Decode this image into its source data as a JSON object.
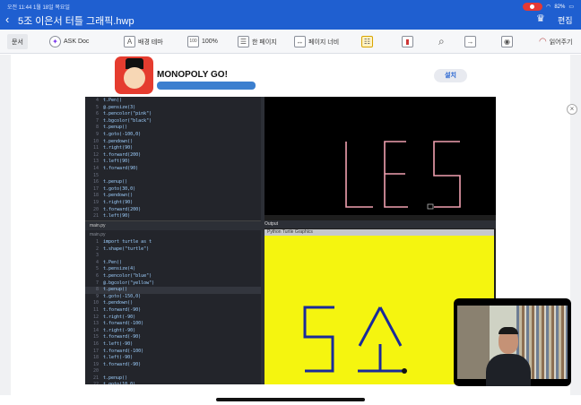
{
  "status": {
    "time_date": "오전 11:44  1월 18일 목요일",
    "battery": "82%"
  },
  "title_bar": {
    "back_glyph": "‹",
    "doc_title": "5조 이은서 터틀 그래픽.hwp",
    "edit_label": "편집"
  },
  "toolbar": {
    "menu_label": "문서",
    "ask_doc": "ASK Doc",
    "background_theme": "배경 테마",
    "zoom": "100%",
    "one_page": "한 페이지",
    "page_width": "페이지 너비",
    "read_aloud": "읽어주기"
  },
  "ad": {
    "title": "MONOPOLY GO!",
    "install_label": "설치",
    "close_glyph": "×"
  },
  "code_top": {
    "lines": [
      {
        "n": "4",
        "t": "t.Pen()"
      },
      {
        "n": "5",
        "t": "@.pensize(3)"
      },
      {
        "n": "6",
        "t": "t.pencolor(\"pink\")"
      },
      {
        "n": "7",
        "t": "t.bgcolor(\"black\")"
      },
      {
        "n": "8",
        "t": "t.penup()"
      },
      {
        "n": "9",
        "t": "t.goto(-100,0)"
      },
      {
        "n": "10",
        "t": "t.pendown()"
      },
      {
        "n": "11",
        "t": "t.right(90)"
      },
      {
        "n": "12",
        "t": "t.forward(200)"
      },
      {
        "n": "13",
        "t": "t.left(90)"
      },
      {
        "n": "14",
        "t": "t.forward(90)"
      },
      {
        "n": "15",
        "t": ""
      },
      {
        "n": "16",
        "t": "t.penup()"
      },
      {
        "n": "17",
        "t": "t.goto(30,0)"
      },
      {
        "n": "18",
        "t": "t.pendown()"
      },
      {
        "n": "19",
        "t": "t.right(90)"
      },
      {
        "n": "20",
        "t": "t.forward(200)"
      },
      {
        "n": "21",
        "t": "t.left(90)"
      },
      {
        "n": "22",
        "t": "t.forward(90)"
      }
    ]
  },
  "code_bottom": {
    "tab_label": "main.py",
    "file_label": "main.py",
    "lines": [
      {
        "n": "1",
        "t": "import turtle as t"
      },
      {
        "n": "2",
        "t": "t.shape(\"turtle\")"
      },
      {
        "n": "3",
        "t": ""
      },
      {
        "n": "4",
        "t": "t.Pen()"
      },
      {
        "n": "5",
        "t": "t.pensize(4)"
      },
      {
        "n": "6",
        "t": "t.pencolor(\"blue\")"
      },
      {
        "n": "7",
        "t": "@.bgcolor(\"yellow\")"
      },
      {
        "n": "8",
        "t": "t.penup()"
      },
      {
        "n": "9",
        "t": "t.goto(-150,0)"
      },
      {
        "n": "10",
        "t": "t.pendown()"
      },
      {
        "n": "11",
        "t": "t.forward(-90)"
      },
      {
        "n": "12",
        "t": "t.right(-90)"
      },
      {
        "n": "13",
        "t": "t.forward(-100)"
      },
      {
        "n": "14",
        "t": "t.right(-90)"
      },
      {
        "n": "15",
        "t": "t.forward(-90)"
      },
      {
        "n": "16",
        "t": "t.left(-90)"
      },
      {
        "n": "17",
        "t": "t.forward(-100)"
      },
      {
        "n": "18",
        "t": "t.left(-90)"
      },
      {
        "n": "19",
        "t": "t.forward(-90)"
      },
      {
        "n": "20",
        "t": ""
      },
      {
        "n": "21",
        "t": "t.penup()"
      },
      {
        "n": "22",
        "t": "t.goto(10,0)"
      }
    ]
  },
  "output": {
    "header_label": "Output",
    "window_title": "Python Turtle Graphics"
  },
  "colors": {
    "header_blue": "#1f5fd0",
    "turtle_pink": "#f0a0b0",
    "turtle_yellow_bg": "#f5f50f",
    "turtle_blue_pen": "#1a2a9a"
  }
}
